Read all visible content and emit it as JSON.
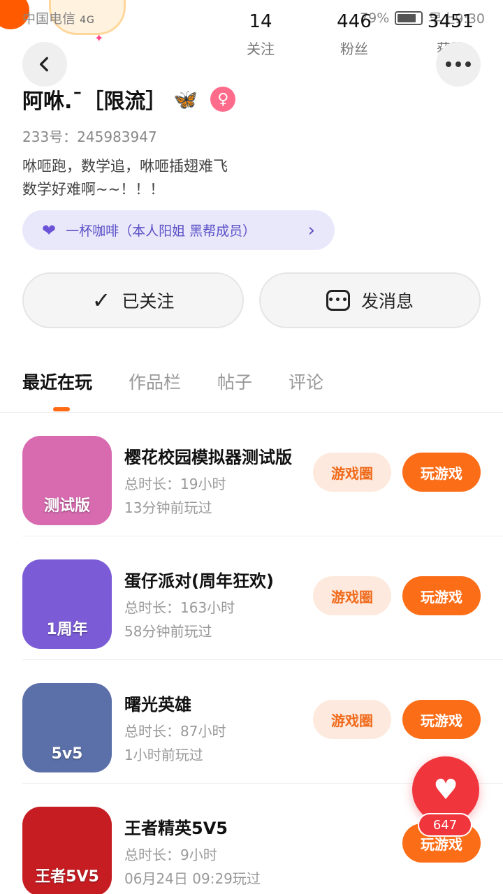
{
  "status_bar": {
    "carrier": "中国电信",
    "network": "4G",
    "battery_pct": "79%",
    "time": "早上9:30"
  },
  "stats": [
    {
      "value": "14",
      "label": "关注"
    },
    {
      "value": "446",
      "label": "粉丝"
    },
    {
      "value": "3451",
      "label": "获赞"
    }
  ],
  "profile": {
    "nickname": "阿咻.ˉ［限流］",
    "id_text": "233号：245983947",
    "bio_line1": "咻咂跑，数学追，咻咂插翅难飞",
    "bio_line2": "数学好难啊~~！！！",
    "club_label": "一杯咖啡（本人阳姐 黑帮成员）"
  },
  "actions": {
    "follow_label": "已关注",
    "message_label": "发消息"
  },
  "tabs": [
    {
      "label": "最近在玩",
      "active": true
    },
    {
      "label": "作品栏",
      "active": false
    },
    {
      "label": "帖子",
      "active": false
    },
    {
      "label": "评论",
      "active": false
    }
  ],
  "games": [
    {
      "name": "樱花校园模拟器测试版",
      "duration": "总时长：19小时",
      "last_played": "13分钟前玩过",
      "icon_text": "测试版",
      "icon_color": "#d86ab0",
      "has_circle": true
    },
    {
      "name": "蛋仔派对(周年狂欢)",
      "duration": "总时长：163小时",
      "last_played": "58分钟前玩过",
      "icon_text": "1周年",
      "icon_color": "#7b5cd6",
      "has_circle": true
    },
    {
      "name": "曙光英雄",
      "duration": "总时长：87小时",
      "last_played": "1小时前玩过",
      "icon_text": "5v5",
      "icon_color": "#5b6fa8",
      "has_circle": true
    },
    {
      "name": "王者精英5V5",
      "duration": "总时长：9小时",
      "last_played": "06月24日 09:29玩过",
      "icon_text": "王者5V5",
      "icon_color": "#c61d23",
      "has_circle": false
    }
  ],
  "buttons": {
    "circle_label": "游戏圈",
    "play_label": "玩游戏"
  },
  "like_fab": {
    "count": "647"
  },
  "colors": {
    "accent": "#fc6d17",
    "like": "#f0353d",
    "club_bg": "#e9e8fb"
  }
}
